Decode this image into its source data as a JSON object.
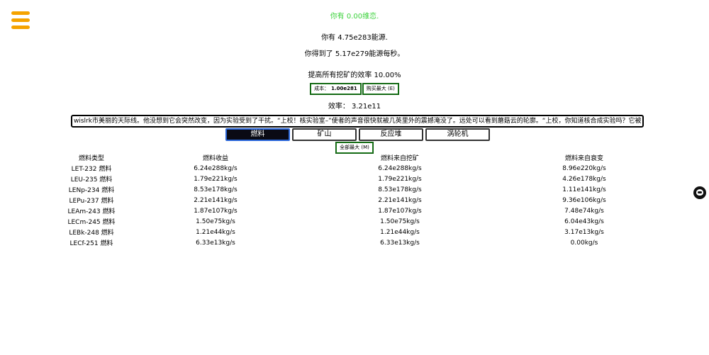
{
  "status": {
    "text": "你有 0.00维恋."
  },
  "energy": {
    "text": "你有 4.75e283能源."
  },
  "rate": {
    "text": "你得到了 5.17e279能源每秒。"
  },
  "boost": {
    "text": "提高所有挖矿的效率 10.00%",
    "cost_label": "成本：",
    "cost_value": "1.00e281",
    "buy_max_label": "购买最大 (E)"
  },
  "efficiency": {
    "text": "效率： 3.21e11"
  },
  "ticker": {
    "text": "wislrk市美丽的天际线。他没想到它会突然改变，因为实验受到了干扰。“上校！核实验室–”使者的声音很快就被几英里外的震撼淹没了。远处可以看到蘑菇云的轮廓。“上校，你知道核合成实验吗？它被"
  },
  "tabs": [
    {
      "label": "燃料",
      "active": true
    },
    {
      "label": "矿山",
      "active": false
    },
    {
      "label": "反应堆",
      "active": false
    },
    {
      "label": "涡轮机",
      "active": false
    }
  ],
  "max_all": {
    "label": "全部最大 (M)"
  },
  "table": {
    "headers": [
      "燃料类型",
      "燃料收益",
      "燃料来自挖矿",
      "燃料来自衰变"
    ],
    "rows": [
      [
        "LET-232 燃料",
        "6.24e288kg/s",
        "6.24e288kg/s",
        "8.96e220kg/s"
      ],
      [
        "LEU-235 燃料",
        "1.79e221kg/s",
        "1.79e221kg/s",
        "4.26e178kg/s"
      ],
      [
        "LENp-234 燃料",
        "8.53e178kg/s",
        "8.53e178kg/s",
        "1.11e141kg/s"
      ],
      [
        "LEPu-237 燃料",
        "2.21e141kg/s",
        "2.21e141kg/s",
        "9.36e106kg/s"
      ],
      [
        "LEAm-243 燃料",
        "1.87e107kg/s",
        "1.87e107kg/s",
        "7.48e74kg/s"
      ],
      [
        "LECm-245 燃料",
        "1.50e75kg/s",
        "1.50e75kg/s",
        "6.04e43kg/s"
      ],
      [
        "LEBk-248 燃料",
        "1.21e44kg/s",
        "1.21e44kg/s",
        "3.17e13kg/s"
      ],
      [
        "LECf-251 燃料",
        "6.33e13kg/s",
        "6.33e13kg/s",
        "0.00kg/s"
      ]
    ]
  },
  "icons": {
    "menu": "hamburger-menu-icon",
    "side": "github-octocat-icon"
  },
  "colors": {
    "menu": "#f5a300",
    "status": "#3bd23b",
    "button_border": "#1f7a1f",
    "active_tab_bg": "#0a0a14",
    "active_tab_border": "#2a66d9"
  }
}
